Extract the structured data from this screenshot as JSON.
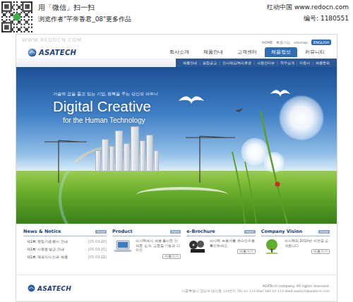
{
  "watermark": {
    "qr_caption": "用「微信」扫一扫",
    "author_line": "浏览作者\"芊帝香君_08\"更多作品",
    "site": "红动中国 www.redocn.com",
    "code": "编号: 1180551",
    "url_mark": "WWW.REDOCN.COM"
  },
  "page": {
    "logo": "ASATECH",
    "top_links": [
      "HOME",
      "회원가입",
      "sitemap"
    ],
    "top_button": "ENGLISH",
    "nav": [
      {
        "label": "회사소개",
        "selected": false
      },
      {
        "label": "제품안내",
        "selected": false
      },
      {
        "label": "고객센터",
        "selected": false
      },
      {
        "label": "채용정보",
        "selected": true
      },
      {
        "label": "커뮤니티",
        "selected": false
      }
    ],
    "sub_nav": [
      "채용안내",
      "모집공고",
      "인사제도/복리후생",
      "사원인터뷰",
      "직무소개",
      "지원서",
      "채용문의"
    ],
    "hero": {
      "tagline": "가슴에 꿈을 품고 있는 기업, 행복을 주는 당신의 파트너",
      "title": "Digital Creative",
      "subtitle": "for the Human Technology"
    },
    "news": {
      "title": "News & Notice",
      "more": "more",
      "items": [
        {
          "text": "ㆍ제1회 창립기념 행사 안내",
          "date": "[05.03.20]"
        },
        {
          "text": "ㆍ제1회 사원증 발급 안내",
          "date": "[05.03.15]"
        },
        {
          "text": "ㆍ제1회 해외지사 신규 채용",
          "date": "[05.03.12]"
        }
      ]
    },
    "cards": [
      {
        "kind": "laptop",
        "title": "Product",
        "more": "more",
        "text": "아사텍에서 새로 출시된 신제품 소개, 고품질 기능과 디자인",
        "button": "바로가기"
      },
      {
        "kind": "film",
        "title": "e-Brochure",
        "more": "more",
        "text": "아사텍 브로셔를 온라인으로 확인하세요",
        "button": "바로가기"
      },
      {
        "kind": "tree",
        "title": "Company Vision",
        "more": "more",
        "text": "아사텍의 2010년 비전을 소개합니다",
        "button": "바로가기"
      }
    ],
    "footer": {
      "logo": "ASATECH",
      "copyright": "ASATech company. All rights reserved.",
      "address": "서울특별시 강남구 대치동 123번지 TEL 02-123-4567 FAX 02-123-4568 asatech@asatech.com"
    }
  }
}
